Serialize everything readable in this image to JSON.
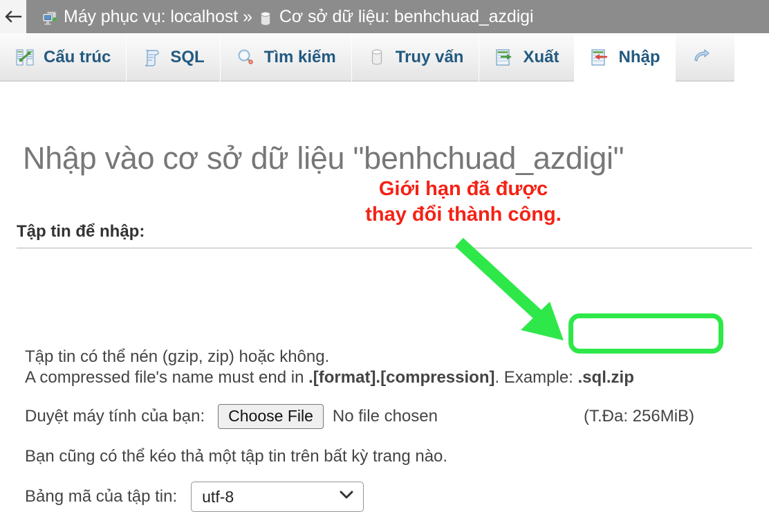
{
  "breadcrumb": {
    "back_icon": "back-arrow-icon",
    "server_icon": "server-monitor-icon",
    "server_label": "Máy phục vụ: localhost",
    "separator": "»",
    "database_icon": "database-cylinder-icon",
    "database_label": "Cơ sở dữ liệu: benhchuad_azdigi"
  },
  "tabs": [
    {
      "label": "Cấu trúc",
      "icon": "structure-icon",
      "active": false
    },
    {
      "label": "SQL",
      "icon": "sql-scroll-icon",
      "active": false
    },
    {
      "label": "Tìm kiếm",
      "icon": "search-magnifier-icon",
      "active": false
    },
    {
      "label": "Truy vấn",
      "icon": "query-cylinder-icon",
      "active": false
    },
    {
      "label": "Xuất",
      "icon": "export-icon",
      "active": false
    },
    {
      "label": "Nhập",
      "icon": "import-icon",
      "active": true
    },
    {
      "label": "",
      "icon": "operations-icon",
      "active": false
    }
  ],
  "main": {
    "page_title": "Nhập vào cơ sở dữ liệu \"benhchuad_azdigi\"",
    "section_title": "Tập tin để nhập:",
    "info_line_1": "Tập tin có thể nén (gzip, zip) hoặc không.",
    "info_line_2_prefix": "A compressed file's name must end in ",
    "info_line_2_bold1": ".[format].[compression]",
    "info_line_2_middle": ". Example: ",
    "info_line_2_bold2": ".sql.zip",
    "browse_label": "Duyệt máy tính của bạn:",
    "choose_file_button": "Choose File",
    "no_file_chosen": "No file chosen",
    "max_size": "(T.Đa: 256MiB)",
    "dragdrop_note": "Bạn cũng có thể kéo thả một tập tin trên bất kỳ trang nào.",
    "charset_label": "Bảng mã của tập tin:",
    "charset_value": "utf-8"
  },
  "annotations": {
    "callout_text": "Giới hạn đã được\nthay đổi thành công.",
    "callout_color": "#f42216",
    "highlight_color": "#2ee84a",
    "arrow_icon": "green-arrow-icon",
    "highlight_box_target": "(T.Đa: 256MiB)"
  }
}
